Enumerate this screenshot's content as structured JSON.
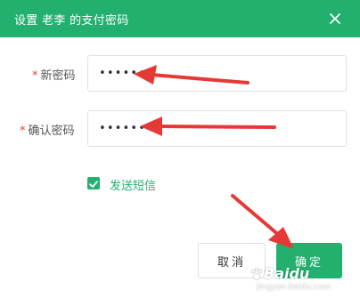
{
  "dialog": {
    "title": "设置 老李 的支付密码",
    "close_icon": "close-icon"
  },
  "form": {
    "required_mark": "*",
    "new_password": {
      "label": "新密码",
      "value": "••••••"
    },
    "confirm_password": {
      "label": "确认密码",
      "value": "••••••"
    },
    "send_sms": {
      "label": "发送短信",
      "checked": true
    }
  },
  "buttons": {
    "cancel": "取消",
    "ok": "确定"
  },
  "colors": {
    "accent": "#23b06f",
    "required": "#e0473c",
    "annotation_arrow": "#e53935"
  },
  "watermark": {
    "brand": "Baidu",
    "sub": "jingyan.baidu.com"
  }
}
